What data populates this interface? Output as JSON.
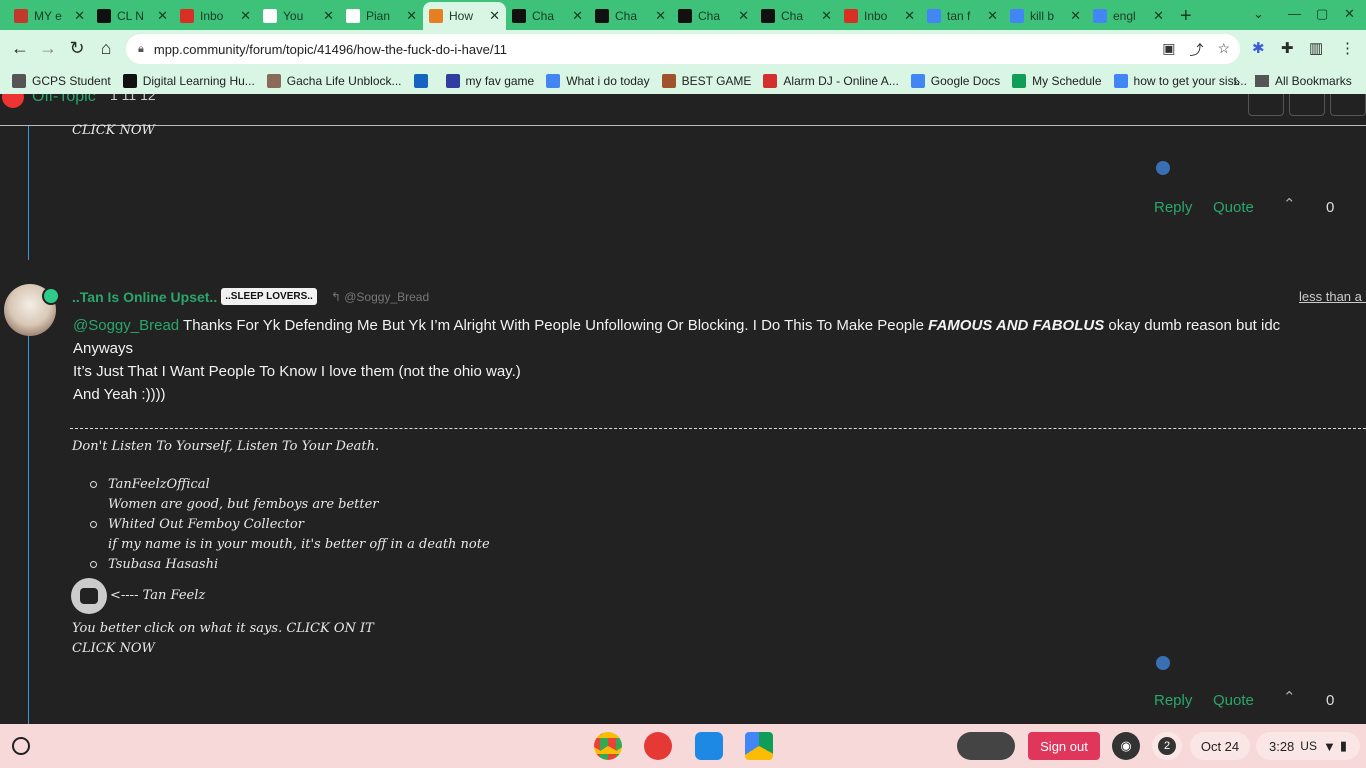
{
  "tabs": [
    {
      "title": "MY e",
      "color": "#c0392b",
      "icon": "fortnite-icon"
    },
    {
      "title": "CL N",
      "color": "#111111",
      "icon": "d2l-icon"
    },
    {
      "title": "Inbo",
      "color": "#d93025",
      "icon": "gmail-icon"
    },
    {
      "title": "You",
      "color": "#ffffff",
      "icon": "piano-icon"
    },
    {
      "title": "Pian",
      "color": "#ffffff",
      "icon": "piano-icon"
    },
    {
      "title": "How",
      "color": "#e67e22",
      "icon": "forum-icon"
    },
    {
      "title": "Cha",
      "color": "#111111",
      "icon": "character-ai-icon"
    },
    {
      "title": "Cha",
      "color": "#111111",
      "icon": "character-ai-icon"
    },
    {
      "title": "Cha",
      "color": "#111111",
      "icon": "character-ai-icon"
    },
    {
      "title": "Cha",
      "color": "#111111",
      "icon": "character-ai-icon"
    },
    {
      "title": "Inbo",
      "color": "#d93025",
      "icon": "gmail-icon"
    },
    {
      "title": "tan f",
      "color": "#4285f4",
      "icon": "google-icon"
    },
    {
      "title": "kill b",
      "color": "#4285f4",
      "icon": "google-icon"
    },
    {
      "title": "engl",
      "color": "#4285f4",
      "icon": "google-icon"
    }
  ],
  "url": "mpp.community/forum/topic/41496/how-the-fuck-do-i-have/11",
  "bookmarks": [
    {
      "label": "GCPS Student",
      "color": "#555555"
    },
    {
      "label": "Digital Learning Hu...",
      "color": "#111111"
    },
    {
      "label": "Gacha Life Unblock...",
      "color": "#8a6a5a"
    },
    {
      "label": "",
      "color": "#1565c0"
    },
    {
      "label": "my fav game",
      "color": "#303f9f"
    },
    {
      "label": "What i do today",
      "color": "#4285f4"
    },
    {
      "label": "BEST GAME",
      "color": "#a0522d"
    },
    {
      "label": "Alarm DJ - Online A...",
      "color": "#d32f2f"
    },
    {
      "label": "Google Docs",
      "color": "#4285f4"
    },
    {
      "label": "My Schedule",
      "color": "#0f9d58"
    },
    {
      "label": "how to get your sist...",
      "color": "#4285f4"
    }
  ],
  "bookmarks_all": "All Bookmarks",
  "topic": {
    "category": "Off-Topic",
    "stats": "1   11   12"
  },
  "prev_post": {
    "click_now": "CLICK NOW",
    "reply": "Reply",
    "quote": "Quote",
    "votes": "0"
  },
  "post": {
    "author": "..Tan Is Online Upset..",
    "badge": "..SLEEP LOVERS..",
    "reply_to": "@Soggy_Bread",
    "time": "less than a m",
    "mention": "@Soggy_Bread",
    "line1_a": " Thanks For Yk Defending Me But Yk I’m Alright With People Unfollowing Or Blocking. I Do This To Make People ",
    "line1_bold": "FAMOUS AND FABOLUS",
    "line1_b": " okay dumb reason but idc",
    "line2": "Anyways",
    "line3": "It’s Just That I Want People To Know I love them (not the ohio way.)",
    "line4": "And Yeah :))))",
    "reply": "Reply",
    "quote": "Quote",
    "votes": "0"
  },
  "signature": {
    "quote": "Don't Listen To Yourself, Listen To Your Death.",
    "items": [
      {
        "name": "TanFeelzOffical",
        "sub": "Women are good, but femboys are better"
      },
      {
        "name": "Whited Out Femboy Collector",
        "sub": "if my name is in your mouth, it's better off in a death note"
      },
      {
        "name": "Tsubasa Hasashi",
        "sub": ""
      }
    ],
    "arrow_text": "<---- Tan Feelz",
    "click_text": "You better click on what it says. CLICK ON IT",
    "click_now": "CLICK NOW"
  },
  "shelf": {
    "signout": "Sign out",
    "notif_count": "2",
    "date": "Oct 24",
    "time": "3:28",
    "locale": "US"
  }
}
